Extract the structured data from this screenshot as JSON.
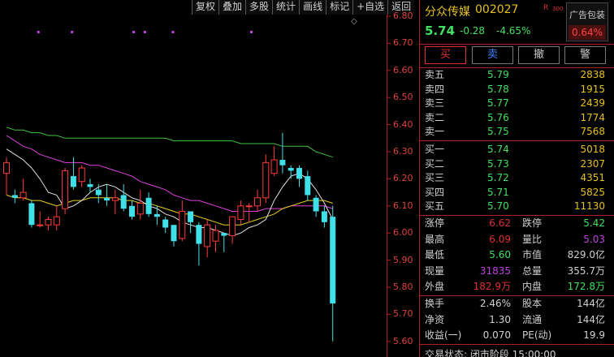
{
  "toolbar": [
    "复权",
    "叠加",
    "多股",
    "统计",
    "画线",
    "标记",
    "+自选",
    "返回"
  ],
  "chart": {
    "y_axis": [
      "6.80",
      "6.70",
      "6.60",
      "6.50",
      "6.40",
      "6.30",
      "6.20",
      "6.10",
      "6.00",
      "5.90",
      "5.80",
      "5.70",
      "5.60"
    ],
    "colors": {
      "up": "#ff3b3b",
      "down": "#40e0e8",
      "ma5": "#e0e0e0",
      "ma10": "#e6d020",
      "ma20": "#e040e0",
      "ma60": "#40c040"
    },
    "candles": [
      [
        6.22,
        6.26,
        6.14,
        6.28
      ],
      [
        6.14,
        6.13,
        6.11,
        6.16
      ],
      [
        6.13,
        6.15,
        6.12,
        6.2
      ],
      [
        6.11,
        6.03,
        6.02,
        6.12
      ],
      [
        6.03,
        6.03,
        6.02,
        6.08
      ],
      [
        6.03,
        6.05,
        6.01,
        6.06
      ],
      [
        6.03,
        6.06,
        6.01,
        6.1
      ],
      [
        6.09,
        6.23,
        6.07,
        6.24
      ],
      [
        6.21,
        6.17,
        6.16,
        6.28
      ],
      [
        6.19,
        6.24,
        6.17,
        6.25
      ],
      [
        6.18,
        6.17,
        6.15,
        6.2
      ],
      [
        6.16,
        6.14,
        6.11,
        6.18
      ],
      [
        6.13,
        6.12,
        6.1,
        6.18
      ],
      [
        6.12,
        6.13,
        6.07,
        6.16
      ],
      [
        6.14,
        6.09,
        6.08,
        6.18
      ],
      [
        6.1,
        6.06,
        6.05,
        6.12
      ],
      [
        6.07,
        6.11,
        6.05,
        6.16
      ],
      [
        6.13,
        6.07,
        6.06,
        6.15
      ],
      [
        6.07,
        6.06,
        6.03,
        6.1
      ],
      [
        6.05,
        6.02,
        6.0,
        6.06
      ],
      [
        6.03,
        5.97,
        5.95,
        6.03
      ],
      [
        5.98,
        6.08,
        5.97,
        6.12
      ],
      [
        6.08,
        6.04,
        6.0,
        6.08
      ],
      [
        6.03,
        5.96,
        5.88,
        6.04
      ],
      [
        5.95,
        6.03,
        5.91,
        6.05
      ],
      [
        5.97,
        6.01,
        5.93,
        6.03
      ],
      [
        6.0,
        5.99,
        5.93,
        6.0
      ],
      [
        5.99,
        6.06,
        5.96,
        6.06
      ],
      [
        6.05,
        6.1,
        6.03,
        6.12
      ],
      [
        6.1,
        6.1,
        6.04,
        6.11
      ],
      [
        6.1,
        6.13,
        6.08,
        6.16
      ],
      [
        6.13,
        6.26,
        6.11,
        6.29
      ],
      [
        6.22,
        6.27,
        6.21,
        6.32
      ],
      [
        6.27,
        6.25,
        6.22,
        6.37
      ],
      [
        6.24,
        6.23,
        6.2,
        6.25
      ],
      [
        6.24,
        6.2,
        6.17,
        6.25
      ],
      [
        6.21,
        6.14,
        6.12,
        6.23
      ],
      [
        6.13,
        6.08,
        6.06,
        6.14
      ],
      [
        6.08,
        6.04,
        6.02,
        6.1
      ],
      [
        6.06,
        5.74,
        5.6,
        6.1
      ]
    ],
    "ma5": [
      6.31,
      6.29,
      6.27,
      6.24,
      6.2,
      6.15,
      6.14,
      6.09,
      6.1,
      6.12,
      6.15,
      6.17,
      6.18,
      6.17,
      6.15,
      6.13,
      6.12,
      6.1,
      6.09,
      6.07,
      6.06,
      6.04,
      6.03,
      6.02,
      6.02,
      6.01,
      6.0,
      5.99,
      6.0,
      6.02,
      6.03,
      6.05,
      6.12,
      6.17,
      6.21,
      6.22,
      6.2,
      6.16,
      6.11,
      6.05
    ],
    "ma10": [
      6.14,
      6.13,
      6.13,
      6.12,
      6.12,
      6.11,
      6.1,
      6.11,
      6.12,
      6.12,
      6.13,
      6.13,
      6.13,
      6.13,
      6.12,
      6.12,
      6.11,
      6.11,
      6.1,
      6.09,
      6.08,
      6.07,
      6.07,
      6.06,
      6.05,
      6.04,
      6.03,
      6.03,
      6.03,
      6.04,
      6.05,
      6.06,
      6.07,
      6.09,
      6.1,
      6.11,
      6.12,
      6.12,
      6.12,
      6.11
    ],
    "ma20": [
      6.36,
      6.34,
      6.32,
      6.31,
      6.29,
      6.28,
      6.27,
      6.26,
      6.26,
      6.26,
      6.25,
      6.25,
      6.24,
      6.23,
      6.22,
      6.21,
      6.19,
      6.18,
      6.17,
      6.16,
      6.14,
      6.13,
      6.12,
      6.12,
      6.11,
      6.1,
      6.09,
      6.08,
      6.08,
      6.08,
      6.08,
      6.09,
      6.09,
      6.09,
      6.1,
      6.1,
      6.1,
      6.1,
      6.1,
      6.09
    ],
    "ma60": [
      6.39,
      6.38,
      6.38,
      6.37,
      6.37,
      6.36,
      6.36,
      6.35,
      6.35,
      6.35,
      6.35,
      6.35,
      6.35,
      6.35,
      6.35,
      6.35,
      6.35,
      6.35,
      6.35,
      6.35,
      6.34,
      6.34,
      6.34,
      6.34,
      6.34,
      6.34,
      6.34,
      6.34,
      6.33,
      6.33,
      6.33,
      6.33,
      6.33,
      6.32,
      6.32,
      6.32,
      6.32,
      6.3,
      6.29,
      6.28
    ]
  },
  "stock": {
    "name": "分众传媒",
    "code": "002027",
    "r_badge": "R",
    "r_badge_num": "300",
    "price": "5.74",
    "change": "-0.28",
    "change_pct": "-4.65%",
    "ad_label": "广告包装",
    "ad_value": "0.64%"
  },
  "buttons": {
    "buy": "买",
    "sell": "卖",
    "cancel": "撤",
    "alert": "警"
  },
  "sell_orders": [
    {
      "label": "卖五",
      "price": "5.79",
      "vol": "2838"
    },
    {
      "label": "卖四",
      "price": "5.78",
      "vol": "1915"
    },
    {
      "label": "卖三",
      "price": "5.77",
      "vol": "2439"
    },
    {
      "label": "卖二",
      "price": "5.76",
      "vol": "1774"
    },
    {
      "label": "卖一",
      "price": "5.75",
      "vol": "7568"
    }
  ],
  "buy_orders": [
    {
      "label": "买一",
      "price": "5.74",
      "vol": "5018"
    },
    {
      "label": "买二",
      "price": "5.73",
      "vol": "2307"
    },
    {
      "label": "买三",
      "price": "5.72",
      "vol": "4351"
    },
    {
      "label": "买四",
      "price": "5.71",
      "vol": "5825"
    },
    {
      "label": "买五",
      "price": "5.70",
      "vol": "11130"
    }
  ],
  "stats1": [
    {
      "l1": "涨停",
      "v1": "6.62",
      "c1": "red",
      "l2": "跌停",
      "v2": "5.42",
      "c2": "green"
    },
    {
      "l1": "最高",
      "v1": "6.09",
      "c1": "red",
      "l2": "量比",
      "v2": "5.03",
      "c2": "purple"
    },
    {
      "l1": "最低",
      "v1": "5.60",
      "c1": "green",
      "l2": "市值",
      "v2": "829.0亿",
      "c2": "white"
    },
    {
      "l1": "现量",
      "v1": "31835",
      "c1": "purple",
      "l2": "总量",
      "v2": "355.7万",
      "c2": "white"
    },
    {
      "l1": "外盘",
      "v1": "182.9万",
      "c1": "red",
      "l2": "内盘",
      "v2": "172.8万",
      "c2": "green"
    }
  ],
  "stats2": [
    {
      "l1": "换手",
      "v1": "2.46%",
      "l2": "股本",
      "v2": "144亿"
    },
    {
      "l1": "净资",
      "v1": "1.30",
      "l2": "流通",
      "v2": "144亿"
    },
    {
      "l1": "收益(一)",
      "v1": "0.070",
      "l2": "PE(动)",
      "v2": "19.9"
    }
  ],
  "status_line": "交易状态: 闭市阶段 15:00:00"
}
